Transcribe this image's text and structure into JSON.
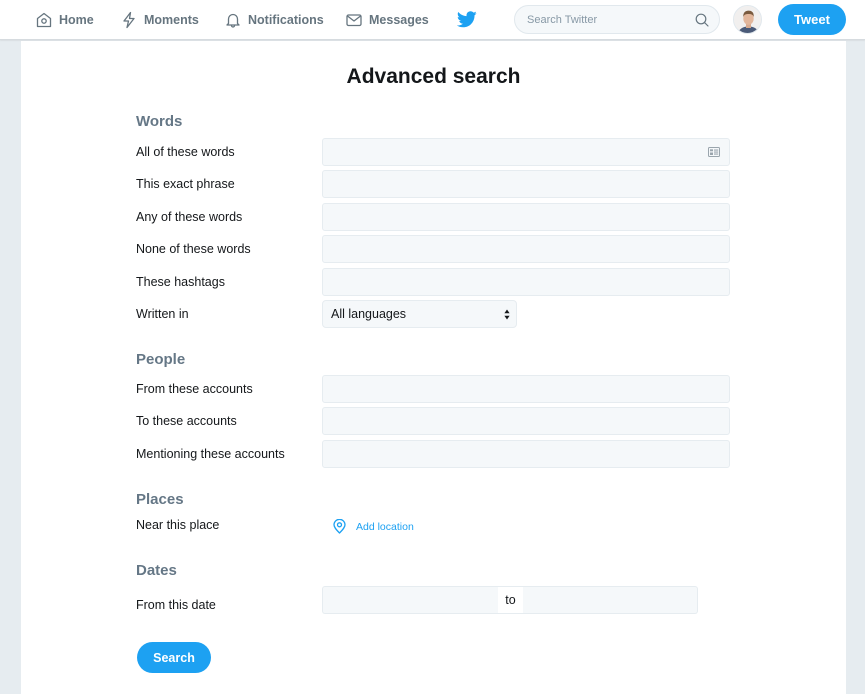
{
  "nav": {
    "items": [
      {
        "label": "Home",
        "icon": "home-icon"
      },
      {
        "label": "Moments",
        "icon": "lightning-icon"
      },
      {
        "label": "Notifications",
        "icon": "bell-icon"
      },
      {
        "label": "Messages",
        "icon": "envelope-icon"
      }
    ],
    "logo": "twitter-bird-icon",
    "search_placeholder": "Search Twitter",
    "tweet_label": "Tweet",
    "brand_color": "#1da1f2"
  },
  "page": {
    "title": "Advanced search"
  },
  "sections": {
    "words": {
      "title": "Words",
      "fields": [
        {
          "label": "All of these words",
          "value": ""
        },
        {
          "label": "This exact phrase",
          "value": ""
        },
        {
          "label": "Any of these words",
          "value": ""
        },
        {
          "label": "None of these words",
          "value": ""
        },
        {
          "label": "These hashtags",
          "value": ""
        }
      ],
      "language": {
        "label": "Written in",
        "selected": "All languages"
      }
    },
    "people": {
      "title": "People",
      "fields": [
        {
          "label": "From these accounts",
          "value": ""
        },
        {
          "label": "To these accounts",
          "value": ""
        },
        {
          "label": "Mentioning these accounts",
          "value": ""
        }
      ]
    },
    "places": {
      "title": "Places",
      "label": "Near this place",
      "add_location": "Add location"
    },
    "dates": {
      "title": "Dates",
      "label": "From this date",
      "separator": "to",
      "from_value": "",
      "to_value": ""
    }
  },
  "actions": {
    "search_label": "Search"
  }
}
